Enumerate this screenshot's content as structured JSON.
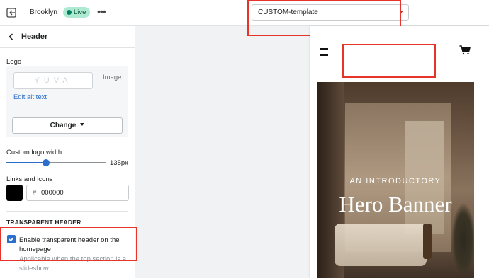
{
  "topbar": {
    "store_name": "Brooklyn",
    "live_badge": "Live",
    "more_label": "•••",
    "template_select": "CUSTOM-template"
  },
  "sidebar": {
    "title": "Header",
    "logo_label": "Logo",
    "logo_placeholder": "YUVA",
    "image_label": "Image",
    "edit_alt_text": "Edit alt text",
    "change_button": "Change",
    "logo_width_label": "Custom logo width",
    "logo_width_value": "135px",
    "logo_width_fraction": 0.4,
    "links_icons_label": "Links and icons",
    "hex_prefix": "#",
    "color_hex": "000000",
    "section_heading": "TRANSPARENT HEADER",
    "transparent_checkbox_label": "Enable transparent header on the homepage",
    "transparent_checked": true,
    "transparent_help": "Applicable when the top section is a slideshow."
  },
  "preview": {
    "hero_pretitle": "AN INTRODUCTORY",
    "hero_title": "Hero Banner"
  },
  "colors": {
    "accent": "#2c6ecb",
    "live_badge_bg": "#aee9d1",
    "highlight": "#e4342b",
    "swatch": "#000000"
  }
}
